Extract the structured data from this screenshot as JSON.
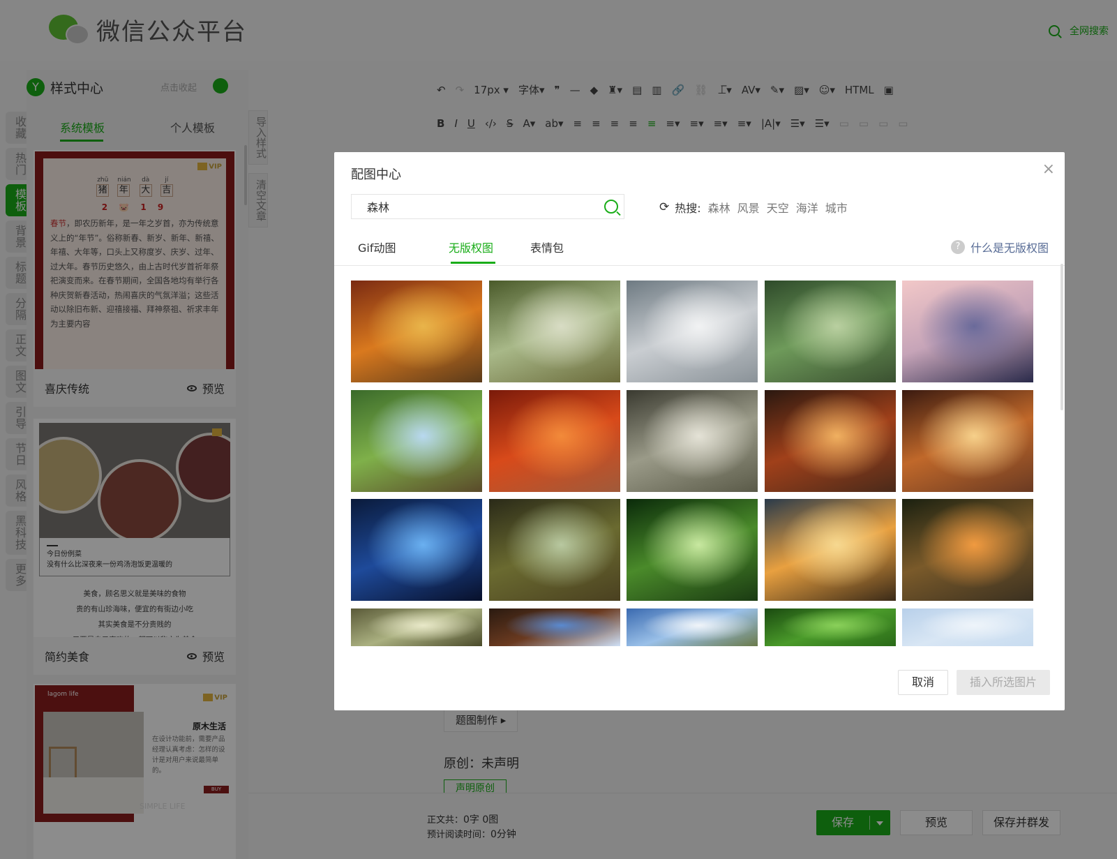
{
  "header": {
    "title": "微信公众平台",
    "global_search": "全网搜索",
    "brand_color": "#1aad19"
  },
  "sidebar": {
    "tabs": [
      {
        "label": "收藏",
        "active": false
      },
      {
        "label": "热门",
        "active": false
      },
      {
        "label": "模板",
        "active": true
      },
      {
        "label": "背景",
        "active": false
      },
      {
        "label": "标题",
        "active": false
      },
      {
        "label": "分隔",
        "active": false
      },
      {
        "label": "正文",
        "active": false
      },
      {
        "label": "图文",
        "active": false
      },
      {
        "label": "引导",
        "active": false
      },
      {
        "label": "节日",
        "active": false
      },
      {
        "label": "风格",
        "active": false
      },
      {
        "label": "黑科技",
        "active": false
      },
      {
        "label": "更多",
        "active": false
      }
    ]
  },
  "style_panel": {
    "logo_letter": "Y",
    "title": "样式中心",
    "collapse_label": "点击收起",
    "tabs": [
      "系统模板",
      "个人模板"
    ],
    "active_tab": "系统模板",
    "preview_label": "预览",
    "templates": [
      {
        "name": "喜庆传统",
        "vip": "VIP",
        "pinyin": [
          {
            "py": "zhū",
            "zi": "猪"
          },
          {
            "py": "nián",
            "zi": "年"
          },
          {
            "py": "dà",
            "zi": "大"
          },
          {
            "py": "jí",
            "zi": "吉"
          }
        ],
        "year": "2 🐷 1 9",
        "body_lead": "春节",
        "body_text": "，即农历新年，是一年之岁首，亦为传统意义上的“年节”。俗称新春、新岁、新年、新禧、年禧、大年等，口头上又称度岁、庆岁、过年、过大年。春节历史悠久，由上古时代岁首祈年祭祀演变而来。在春节期间，全国各地均有举行各种庆贺新春活动，热闹喜庆的气氛洋溢；这些活动以除旧布新、迎禧接福、拜神祭祖、祈求丰年为主要内容"
      },
      {
        "name": "简约美食",
        "caption_1": "今日份例菜",
        "caption_2": "没有什么比深夜来一份鸡汤泡饭更温暖的",
        "lines": [
          "美食，顾名思义就是美味的食物",
          "贵的有山珍海味，便宜的有街边小吃",
          "其实美食是不分贵贱的",
          "只要是自己喜欢的，都可以称之为美食"
        ]
      },
      {
        "name": "原木生活",
        "vip": "VIP",
        "tag": "lagom life",
        "title": "原木生活",
        "text": "在设计功能前，需要产品经理认真考虑：怎样的设计是对用户来说最简单的。",
        "buy": "BUY",
        "watermark": "SIMPLE LIFE"
      }
    ]
  },
  "side_tools": [
    "导入样式",
    "清空文章"
  ],
  "toolbar": {
    "row1": [
      "↶",
      "↷",
      "17px ▾",
      "字体▾",
      "❞",
      "—",
      "◆",
      "♜▾",
      "▤",
      "▥",
      "🔗",
      "⛓",
      "⊥̅▾",
      "AV▾",
      "✎▾",
      "▨▾",
      "☺▾",
      "HTML",
      "▣"
    ],
    "row2": [
      "B",
      "I",
      "U",
      "‹/›",
      "S̶",
      "A▾",
      "ab▾",
      "≡",
      "≡",
      "≡",
      "≡",
      "≡",
      "≡▾",
      "≡▾",
      "≡▾",
      "≡▾",
      "|A|▾",
      "☰▾",
      "☰▾",
      "▭",
      "▭",
      "▭",
      "▭"
    ]
  },
  "editor": {
    "subtitle_button": "题图制作 ▸",
    "original_status": "原创：未声明",
    "declare_button": "声明原创"
  },
  "bottom": {
    "stats_line1_label": "正文共：",
    "stats_line1_value": "0字 0图",
    "stats_line2_label": "预计阅读时间：",
    "stats_line2_value": "0分钟",
    "save": "保存",
    "preview": "预览",
    "save_send": "保存并群发"
  },
  "modal": {
    "title": "配图中心",
    "close": "×",
    "search_value": "森林",
    "hot_label": "热搜:",
    "hot_words": [
      "森林",
      "风景",
      "天空",
      "海洋",
      "城市"
    ],
    "tabs": [
      "Gif动图",
      "无版权图",
      "表情包"
    ],
    "active_tab": "无版权图",
    "help_link": "什么是无版权图",
    "cancel": "取消",
    "insert": "插入所选图片",
    "images": [
      {
        "name": "autumn-forest-path"
      },
      {
        "name": "misty-birch-forest"
      },
      {
        "name": "foggy-mountains-wolf"
      },
      {
        "name": "green-misty-forest"
      },
      {
        "name": "purple-mountain-sunset"
      },
      {
        "name": "watermill-in-forest"
      },
      {
        "name": "red-autumn-road"
      },
      {
        "name": "sunbeams-through-forest"
      },
      {
        "name": "glowing-forest-path"
      },
      {
        "name": "wooden-bridge-in-light"
      },
      {
        "name": "blue-butterflies-night"
      },
      {
        "name": "tree-trunk-by-lake"
      },
      {
        "name": "light-rays-green-forest"
      },
      {
        "name": "sunset-over-lake"
      },
      {
        "name": "sunlit-forest-trail"
      },
      {
        "name": "hazy-forest-meadow"
      },
      {
        "name": "tall-trunks-blue-sky"
      },
      {
        "name": "clouds-and-treetops"
      },
      {
        "name": "green-leaves-close-up"
      },
      {
        "name": "pale-blue-sky-clouds"
      }
    ]
  }
}
